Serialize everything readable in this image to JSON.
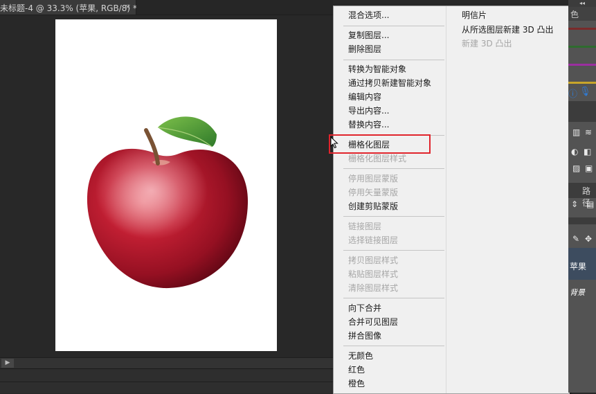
{
  "document_tab": {
    "title": "未标题-4 @ 33.3% (苹果, RGB/8) *",
    "close": "×"
  },
  "context_menu": {
    "left_column": [
      {
        "label": "混合选项...",
        "enabled": true
      },
      {
        "label": "复制图层...",
        "enabled": true
      },
      {
        "label": "删除图层",
        "enabled": true
      },
      {
        "label": "转换为智能对象",
        "enabled": true
      },
      {
        "label": "通过拷贝新建智能对象",
        "enabled": true
      },
      {
        "label": "编辑内容",
        "enabled": true
      },
      {
        "label": "导出内容...",
        "enabled": true
      },
      {
        "label": "替换内容...",
        "enabled": true
      },
      {
        "label": "栅格化图层",
        "enabled": true
      },
      {
        "label": "栅格化图层样式",
        "enabled": false
      },
      {
        "label": "停用图层蒙版",
        "enabled": false
      },
      {
        "label": "停用矢量蒙版",
        "enabled": false
      },
      {
        "label": "创建剪贴蒙版",
        "enabled": true
      },
      {
        "label": "链接图层",
        "enabled": false
      },
      {
        "label": "选择链接图层",
        "enabled": false
      },
      {
        "label": "拷贝图层样式",
        "enabled": false
      },
      {
        "label": "粘贴图层样式",
        "enabled": false
      },
      {
        "label": "清除图层样式",
        "enabled": false
      },
      {
        "label": "向下合并",
        "enabled": true
      },
      {
        "label": "合并可见图层",
        "enabled": true
      },
      {
        "label": "拼合图像",
        "enabled": true
      },
      {
        "label": "无颜色",
        "enabled": true
      },
      {
        "label": "红色",
        "enabled": true
      },
      {
        "label": "橙色",
        "enabled": true
      }
    ],
    "right_column": [
      {
        "label": "明信片",
        "enabled": true
      },
      {
        "label": "从所选图层新建 3D 凸出",
        "enabled": true
      },
      {
        "label": "新建 3D 凸出",
        "enabled": false
      }
    ],
    "highlighted_item": "栅格化图层"
  },
  "right_panel": {
    "collapse_label": "◂◂",
    "tab_fragment": "色",
    "path_tab_fragment": "路径",
    "layer_name_fragment": "苹果",
    "fx_fragment": "背景",
    "swatch_colors": [
      "#7a2a2a",
      "#2e6b2e",
      "#9b2ea0",
      "#c8a52a"
    ]
  },
  "colors": {
    "highlight_border": "#e0242c",
    "layer_selected": "#3d4c5f"
  }
}
